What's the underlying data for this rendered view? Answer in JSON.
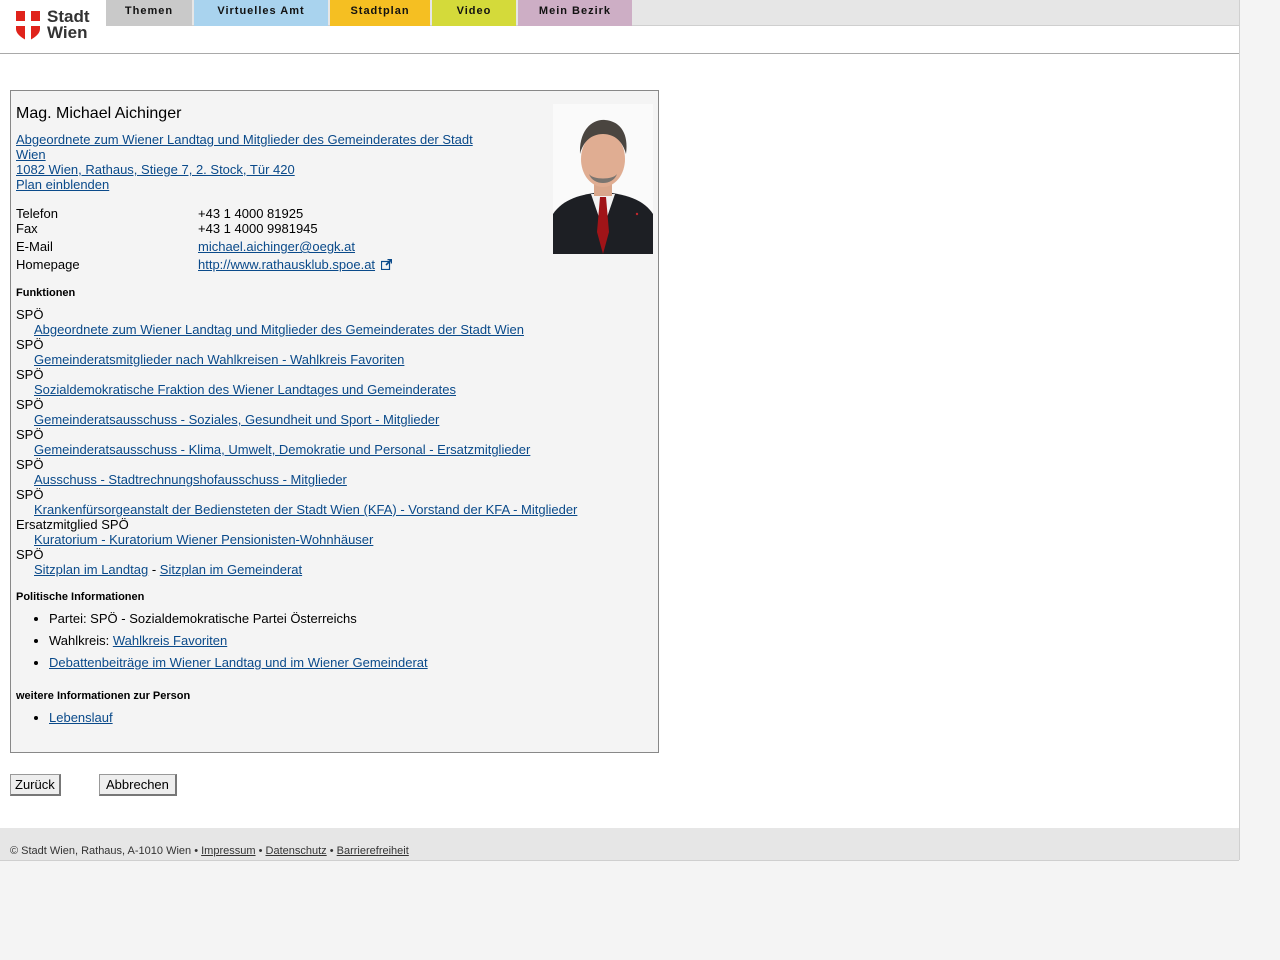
{
  "header": {
    "logo_line1": "Stadt",
    "logo_line2": "Wien",
    "tabs": [
      {
        "label": "Themen",
        "color": "#c9c9c9"
      },
      {
        "label": "Virtuelles Amt",
        "color": "#a9d3ee"
      },
      {
        "label": "Stadtplan",
        "color": "#f5bf22"
      },
      {
        "label": "Video",
        "color": "#d4da3a"
      },
      {
        "label": "Mein Bezirk",
        "color": "#cdaec5"
      }
    ]
  },
  "person": {
    "name": "Mag. Michael Aichinger",
    "position_link": "Abgeordnete zum Wiener Landtag und Mitglieder des Gemeinderates der Stadt Wien",
    "address_link": "1082 Wien, Rathaus, Stiege 7, 2. Stock, Tür 420",
    "plan_link": "Plan einblenden",
    "contact": {
      "telefon_label": "Telefon",
      "telefon": "+43 1 4000 81925",
      "fax_label": "Fax",
      "fax": "+43 1 4000 9981945",
      "email_label": "E-Mail",
      "email": "michael.aichinger@oegk.at",
      "homepage_label": "Homepage",
      "homepage": "http://www.rathausklub.spoe.at"
    }
  },
  "funktionen": {
    "heading": "Funktionen",
    "items": [
      {
        "party": "SPÖ",
        "link": "Abgeordnete zum Wiener Landtag und Mitglieder des Gemeinderates der Stadt Wien"
      },
      {
        "party": "SPÖ",
        "link": "Gemeinderatsmitglieder nach Wahlkreisen - Wahlkreis Favoriten"
      },
      {
        "party": "SPÖ",
        "link": "Sozialdemokratische Fraktion des Wiener Landtages und Gemeinderates"
      },
      {
        "party": "SPÖ",
        "link": "Gemeinderatsausschuss - Soziales, Gesundheit und Sport - Mitglieder"
      },
      {
        "party": "SPÖ",
        "link": "Gemeinderatsausschuss - Klima, Umwelt, Demokratie und Personal - Ersatzmitglieder"
      },
      {
        "party": "SPÖ",
        "link": "Ausschuss - Stadtrechnungshofausschuss - Mitglieder"
      },
      {
        "party": "SPÖ",
        "link": "Krankenfürsorgeanstalt der Bediensteten der Stadt Wien (KFA) - Vorstand der KFA - Mitglieder"
      },
      {
        "party": "Ersatzmitglied SPÖ",
        "link": "Kuratorium - Kuratorium Wiener Pensionisten-Wohnhäuser"
      }
    ],
    "last_party": "SPÖ",
    "sitzplan_landtag": "Sitzplan im Landtag",
    "separator": "-",
    "sitzplan_gemeinderat": "Sitzplan im Gemeinderat"
  },
  "politisch": {
    "heading": "Politische Informationen",
    "partei": "Partei: SPÖ - Sozialdemokratische Partei Österreichs",
    "wahlkreis_label": "Wahlkreis:",
    "wahlkreis_link": "Wahlkreis Favoriten",
    "debatten_link": "Debattenbeiträge im Wiener Landtag und im Wiener Gemeinderat"
  },
  "weitere": {
    "heading": "weitere Informationen zur Person",
    "lebenslauf": "Lebenslauf"
  },
  "buttons": {
    "back": "Zurück",
    "cancel": "Abbrechen"
  },
  "footer": {
    "copyright": "© Stadt Wien, Rathaus, A-1010 Wien",
    "bullet": "•",
    "impressum": "Impressum",
    "datenschutz": "Datenschutz",
    "barrierefreiheit": "Barrierefreiheit"
  }
}
